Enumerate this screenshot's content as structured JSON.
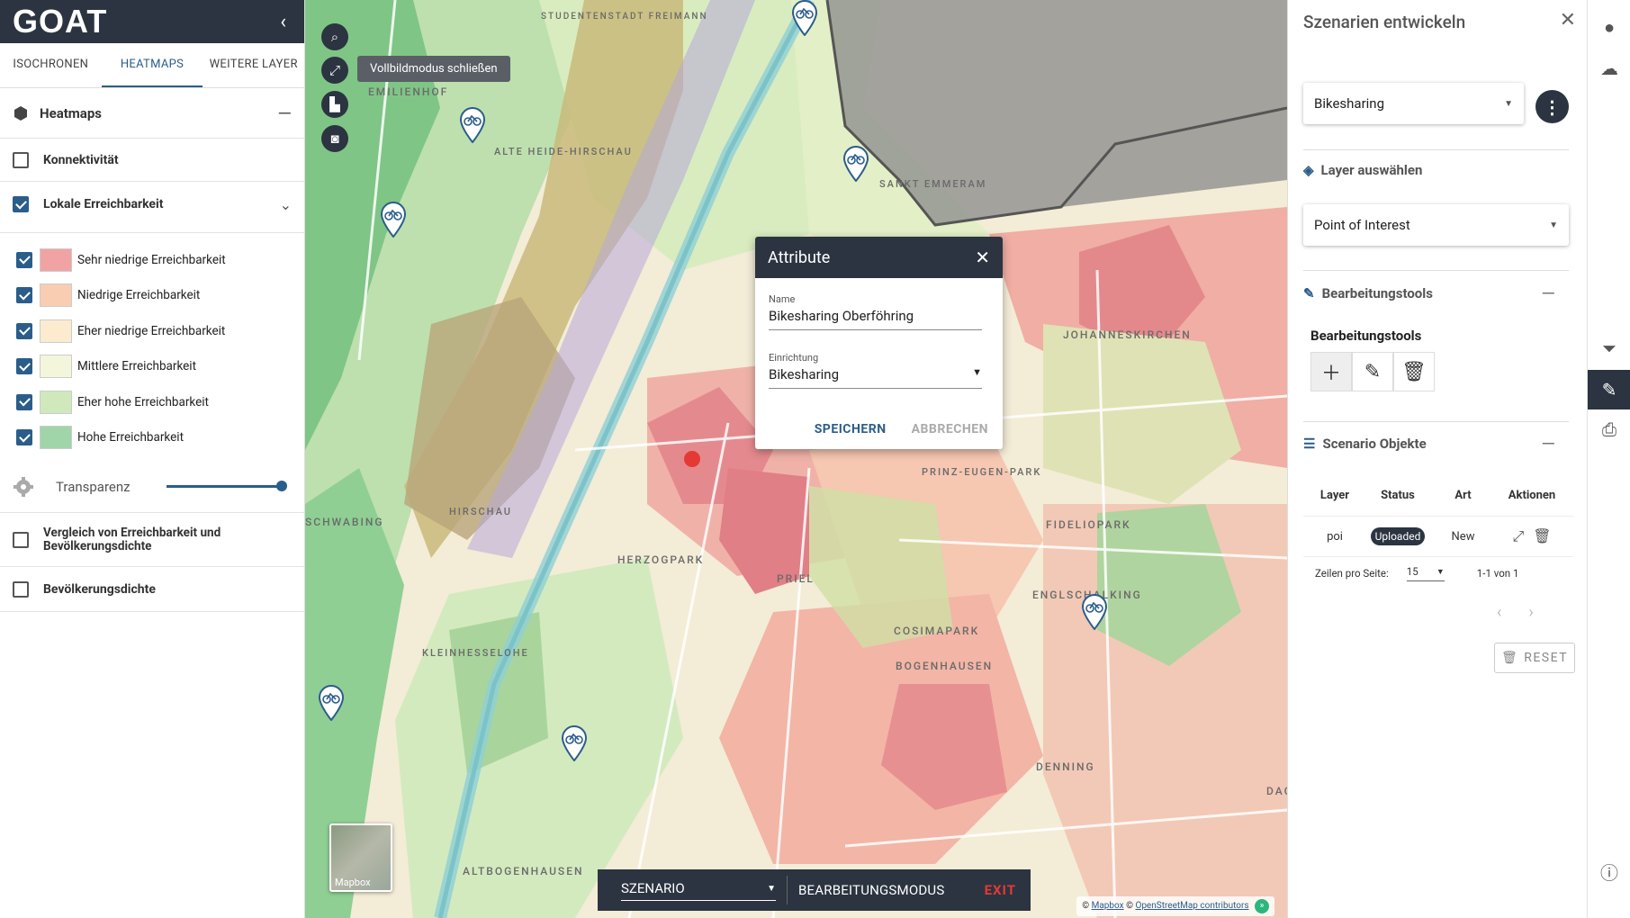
{
  "app": {
    "logo": "GOAT"
  },
  "tabs": [
    "ISOCHRONEN",
    "HEATMAPS",
    "WEITERE LAYER"
  ],
  "left": {
    "heatmaps_title": "Heatmaps",
    "konnektivitaet": "Konnektivität",
    "lokale": "Lokale Erreichbarkeit",
    "legend": [
      {
        "label": "Sehr niedrige Erreichbarkeit",
        "color": "#f1a3a3"
      },
      {
        "label": "Niedrige Erreichbarkeit",
        "color": "#f9cdb2"
      },
      {
        "label": "Eher niedrige Erreichbarkeit",
        "color": "#fdebcf"
      },
      {
        "label": "Mittlere Erreichbarkeit",
        "color": "#f3f6db"
      },
      {
        "label": "Eher hohe Erreichbarkeit",
        "color": "#cfe9bd"
      },
      {
        "label": "Hohe Erreichbarkeit",
        "color": "#9fd5a8"
      }
    ],
    "transparenz": "Transparenz",
    "slider_value": 1.0,
    "vergleich": "Vergleich von Erreichbarkeit und Bevölkerungsdichte",
    "bevoelkerung": "Bevölkerungsdichte"
  },
  "map": {
    "tooltip": "Vollbildmodus schließen",
    "labels": [
      "EMILIENHOF",
      "ALTE HEIDE-HIRSCHAU",
      "SANKT EMMERAM",
      "JOHANNESKIRCHEN",
      "PRINZ-EUGEN-PARK",
      "FIDELIOPARK",
      "HERZOGPARK",
      "PRIEL",
      "ENGLSCHALKING",
      "COSIMAPARK",
      "BOGENHAUSEN",
      "KLEINHESSELOHE",
      "DENNING",
      "ALTBOGENHAUSEN",
      "HIRSCHAU",
      "SCHWABING",
      "STUDENTENSTADT FREIMANN",
      "DAG"
    ],
    "minimap": "Mapbox",
    "attribution": {
      "prefix": "©",
      "mapbox": "Mapbox",
      "sep": "©",
      "osm": "OpenStreetMap contributors"
    }
  },
  "dialog": {
    "title": "Attribute",
    "name_label": "Name",
    "name_value": "Bikesharing Oberföhring",
    "einrichtung_label": "Einrichtung",
    "einrichtung_value": "Bikesharing",
    "save": "SPEICHERN",
    "cancel": "ABBRECHEN"
  },
  "bottombar": {
    "scenario": "SZENARIO",
    "mode": "BEARBEITUNGSMODUS",
    "exit": "EXIT"
  },
  "right": {
    "title": "Szenarien entwickeln",
    "scenario_select": "Bikesharing",
    "layer_title": "Layer auswählen",
    "layer_select": "Point of Interest",
    "tools_title": "Bearbeitungstools",
    "tools_label": "Bearbeitungstools",
    "objects_title": "Scenario Objekte",
    "table_headers": [
      "Layer",
      "Status",
      "Art",
      "Aktionen"
    ],
    "table_rows": [
      {
        "layer": "poi",
        "status": "Uploaded",
        "art": "New"
      }
    ],
    "rows_per_page_label": "Zeilen pro Seite:",
    "rows_per_page": "15",
    "range": "1-1 von 1",
    "reset": "RESET"
  },
  "colors": {
    "dark": "#2b3440",
    "accent": "#2b5d8b",
    "exit": "#e53935"
  }
}
